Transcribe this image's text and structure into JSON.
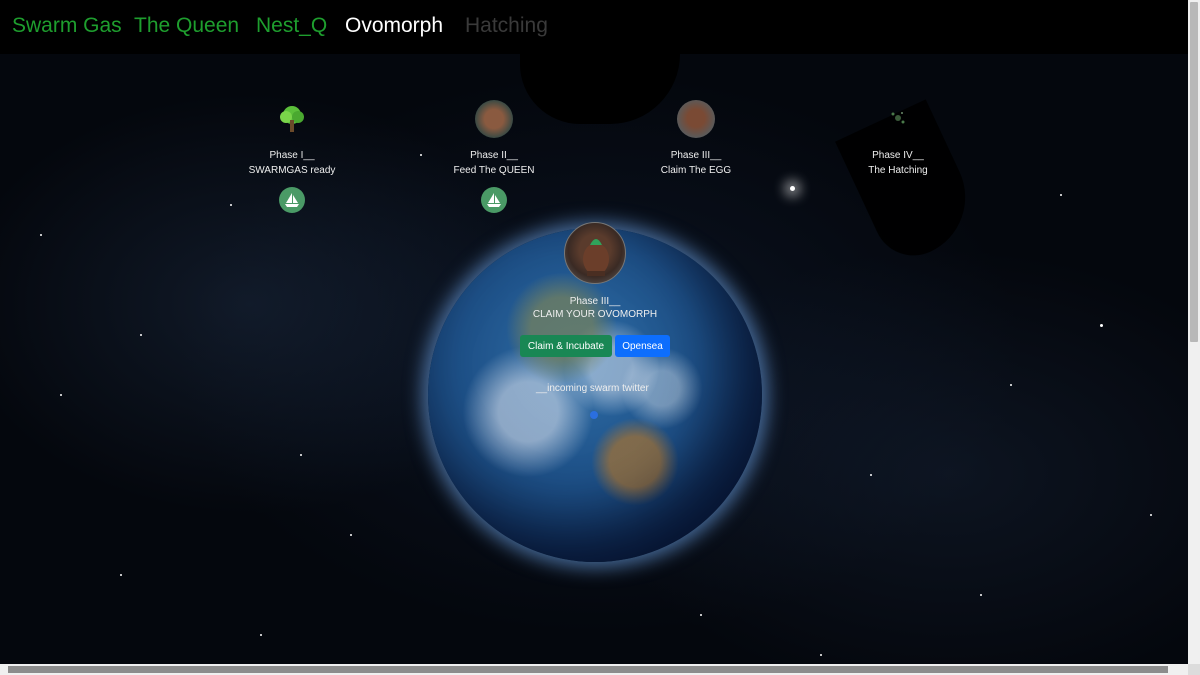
{
  "nav": {
    "items": [
      {
        "label": "Swarm Gas",
        "color": "#1e9e2e"
      },
      {
        "label": "The Queen",
        "color": "#1e9e2e"
      },
      {
        "label": "Nest_Q",
        "color": "#1e9e2e"
      },
      {
        "label": "Ovomorph",
        "color": "#ffffff"
      },
      {
        "label": "Hatching",
        "color": "#3a3a3a"
      }
    ]
  },
  "phases": [
    {
      "title": "Phase I__",
      "subtitle": "SWARMGAS ready",
      "icon": "tree-icon"
    },
    {
      "title": "Phase II__",
      "subtitle": "Feed The QUEEN",
      "icon": "queen-avatar-icon"
    },
    {
      "title": "Phase III__",
      "subtitle": "Claim The EGG",
      "icon": "egg-avatar-icon"
    },
    {
      "title": "Phase IV__",
      "subtitle": "The Hatching",
      "icon": "hatching-icon"
    }
  ],
  "center": {
    "title": "Phase III__",
    "subtitle": "CLAIM YOUR OVOMORPH",
    "claim_button": "Claim & Incubate",
    "opensea_button": "Opensea",
    "twitter_text": "__incoming swarm twitter"
  },
  "colors": {
    "claim_button": "#198754",
    "opensea_button": "#0d6efd",
    "sail_button": "#4a9a66"
  }
}
